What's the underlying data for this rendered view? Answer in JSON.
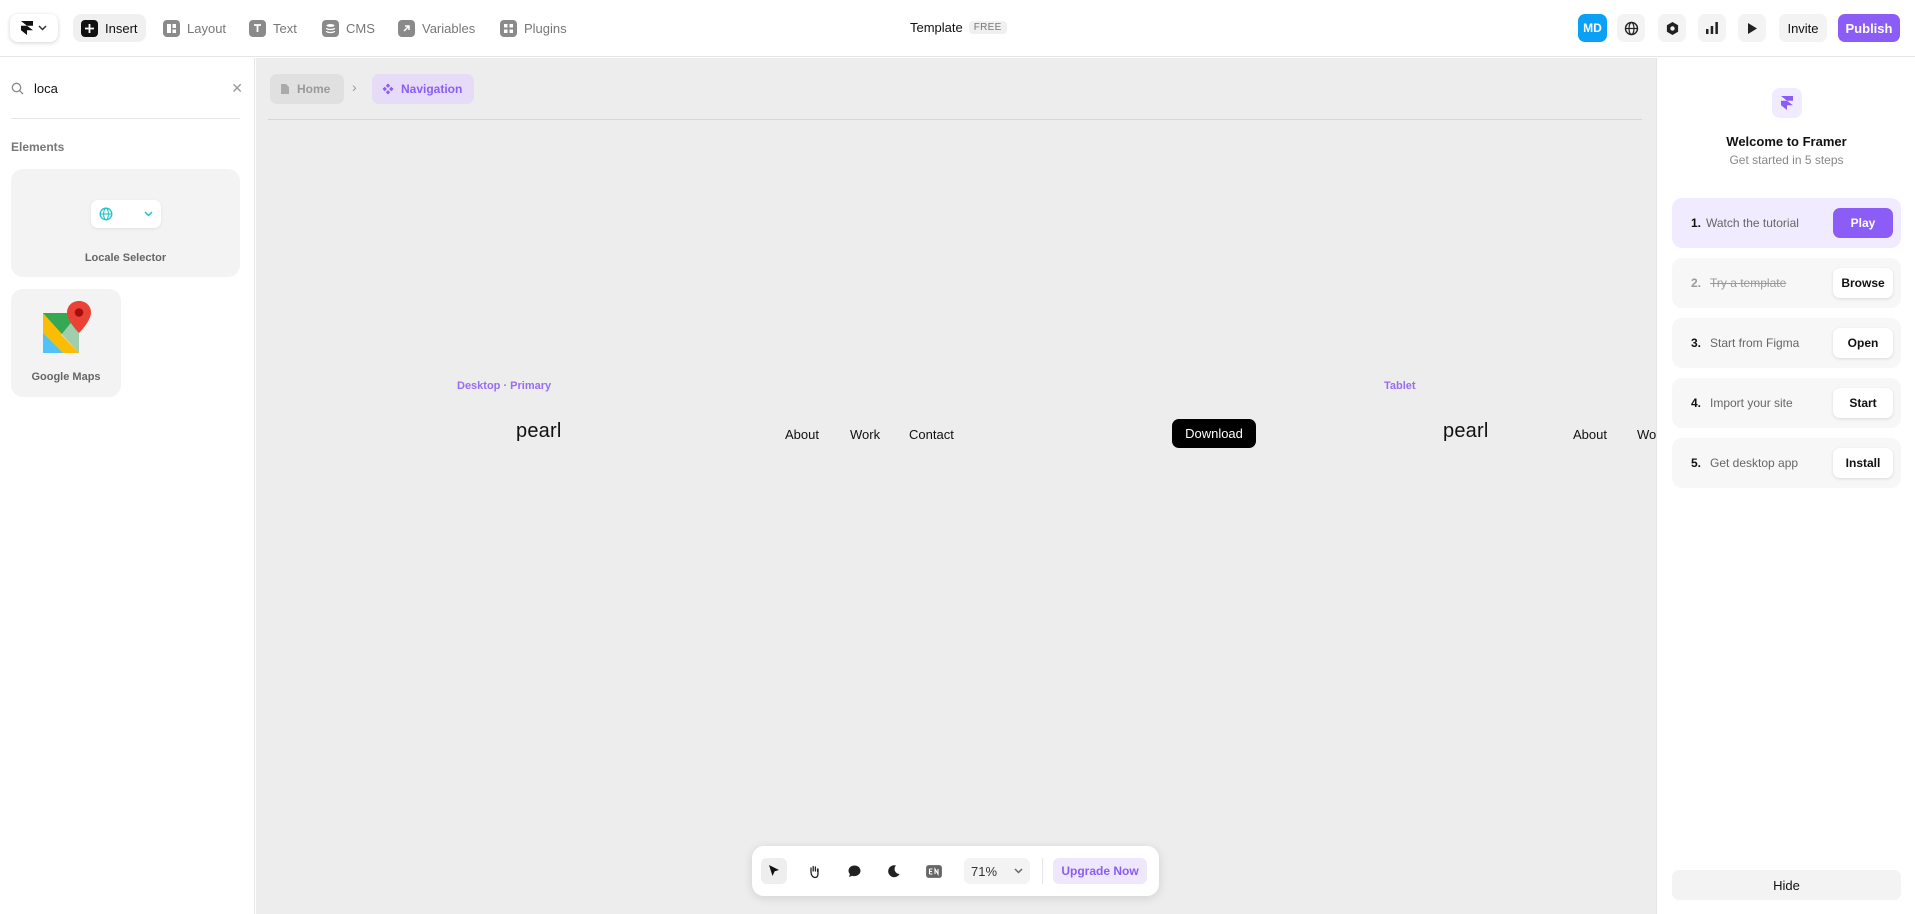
{
  "toolbar": {
    "tools": [
      {
        "label": "Insert",
        "icon": "plus-icon",
        "active": true
      },
      {
        "label": "Layout",
        "icon": "layout-icon",
        "active": false
      },
      {
        "label": "Text",
        "icon": "text-icon",
        "active": false
      },
      {
        "label": "CMS",
        "icon": "database-icon",
        "active": false
      },
      {
        "label": "Variables",
        "icon": "arrow-up-right-icon",
        "active": false
      },
      {
        "label": "Plugins",
        "icon": "plugins-icon",
        "active": false
      }
    ],
    "project_title": "Template",
    "plan_badge": "FREE",
    "avatar_initials": "MD",
    "invite_label": "Invite",
    "publish_label": "Publish"
  },
  "left_panel": {
    "search": {
      "value": "loca",
      "placeholder": ""
    },
    "section_title": "Elements",
    "elements": [
      {
        "label": "Locale Selector",
        "icon": "globe-icon"
      },
      {
        "label": "Google Maps",
        "icon": "google-maps-icon"
      }
    ]
  },
  "canvas": {
    "breadcrumb": {
      "home": "Home",
      "current": "Navigation"
    },
    "frames": [
      {
        "label": "Desktop · Primary"
      },
      {
        "label": "Tablet"
      }
    ],
    "site": {
      "logo": "pearl",
      "links": [
        "About",
        "Work",
        "Contact"
      ],
      "button": "Download",
      "tablet_logo": "pearl",
      "tablet_link_1": "About",
      "tablet_link_2": "Wo"
    }
  },
  "bottom_toolbar": {
    "zoom": "71%",
    "upgrade_label": "Upgrade Now"
  },
  "right_panel": {
    "title": "Welcome to Framer",
    "subtitle": "Get started in 5 steps",
    "steps": [
      {
        "num": "1.",
        "text": "Watch the tutorial",
        "button": "Play",
        "done": false
      },
      {
        "num": "2.",
        "text": "Try a template",
        "button": "Browse",
        "done": true
      },
      {
        "num": "3.",
        "text": "Start from Figma",
        "button": "Open",
        "done": false
      },
      {
        "num": "4.",
        "text": "Import your site",
        "button": "Start",
        "done": false
      },
      {
        "num": "5.",
        "text": "Get desktop app",
        "button": "Install",
        "done": false
      }
    ],
    "hide_label": "Hide"
  },
  "colors": {
    "accent": "#8b5cf6",
    "avatar": "#0aa0f5",
    "canvas": "#ededed"
  }
}
